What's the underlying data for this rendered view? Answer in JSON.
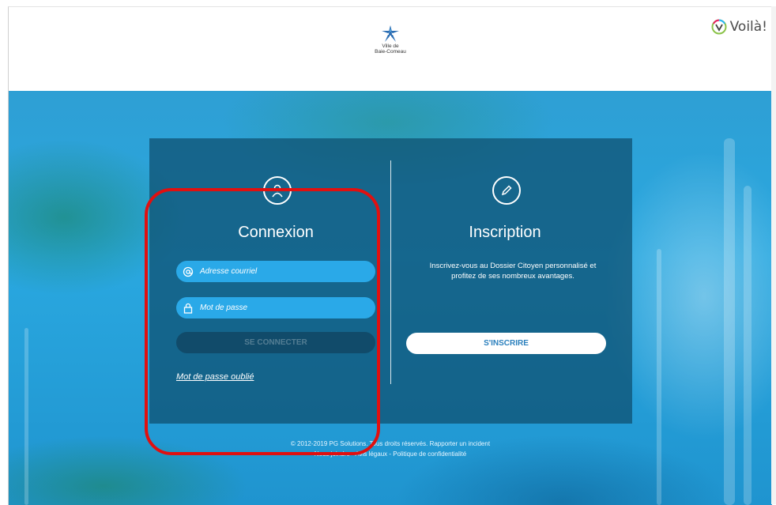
{
  "header": {
    "city_logo": {
      "line1": "Ville de",
      "line2": "Baie-Comeau",
      "icon": "snowflake-star-icon"
    },
    "voila": {
      "label": "Voilà!",
      "icon": "voila-v-logo-icon"
    }
  },
  "login": {
    "icon": "user-icon",
    "title": "Connexion",
    "email_placeholder": "Adresse courriel",
    "email_icon": "at-sign-icon",
    "password_placeholder": "Mot de passe",
    "password_icon": "lock-icon",
    "submit_label": "SE CONNECTER",
    "forgot_label": "Mot de passe oublié"
  },
  "register": {
    "icon": "pencil-icon",
    "title": "Inscription",
    "description": "Inscrivez-vous au Dossier Citoyen personnalisé et profitez de ses nombreux avantages.",
    "button_label": "S'INSCRIRE"
  },
  "footer": {
    "copyright": "© 2012-2019 PG Solutions. Tous droits réservés.",
    "report_incident": "Rapporter un incident",
    "contact": "Nous joindre",
    "legal": "Avis légaux",
    "privacy": "Politique de confidentialité"
  },
  "colors": {
    "field_blue": "#2aa9e8",
    "panel": "#0e4e6e",
    "annotation_red": "#e01010",
    "register_text": "#2a7fbd"
  }
}
